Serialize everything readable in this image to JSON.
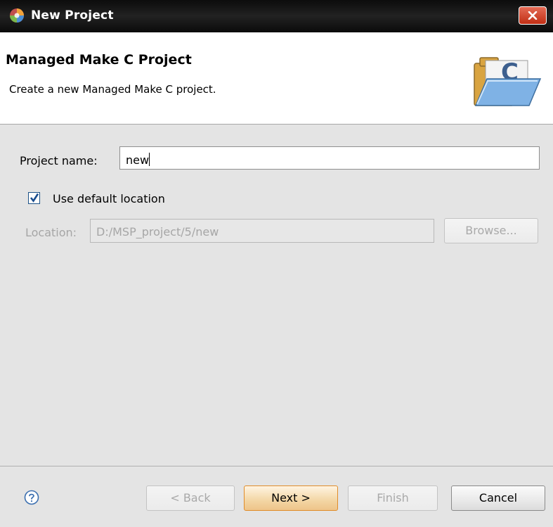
{
  "window": {
    "title": "New Project",
    "icon": "eclipse-new-project-icon"
  },
  "banner": {
    "title": "Managed Make C Project",
    "description": "Create a new Managed Make C project.",
    "icon": "c-project-folder-icon",
    "icon_letter": "C"
  },
  "form": {
    "project_name_label": "Project name:",
    "project_name_value": "new",
    "use_default_location_label": "Use default location",
    "use_default_location_checked": true,
    "location_label": "Location:",
    "location_value": "D:/MSP_project/5/new",
    "browse_label": "Browse..."
  },
  "footer": {
    "help_icon": "help-icon",
    "back_label": "< Back",
    "next_label": "Next >",
    "finish_label": "Finish",
    "cancel_label": "Cancel"
  },
  "colors": {
    "titlebar": "#111111",
    "close_button": "#d4462c",
    "default_button_border": "#e08c2a",
    "disabled_text": "#a6a6a6"
  }
}
